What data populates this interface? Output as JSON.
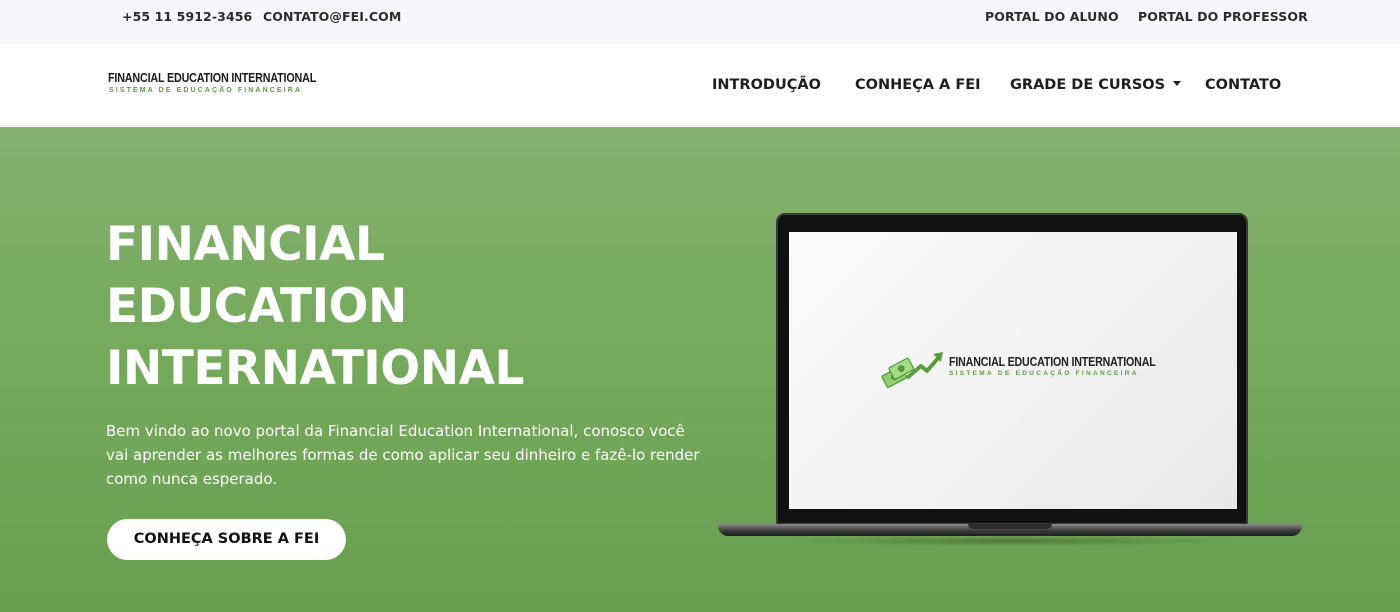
{
  "topbar": {
    "phone": "+55 11 5912-3456",
    "email": "CONTATO@FEI.COM",
    "portal_aluno": "PORTAL DO ALUNO",
    "portal_professor": "PORTAL DO PROFESSOR"
  },
  "brand": {
    "title": "FINANCIAL EDUCATION INTERNATIONAL",
    "subtitle": "SISTEMA DE EDUCAÇÃO FINANCEIRA"
  },
  "nav": {
    "items": [
      {
        "label": "INTRODUÇÃO"
      },
      {
        "label": "CONHEÇA A FEI"
      },
      {
        "label": "GRADE DE CURSOS",
        "has_dropdown": true
      },
      {
        "label": "CONTATO"
      }
    ]
  },
  "hero": {
    "title_lines": [
      "FINANCIAL",
      "EDUCATION",
      "INTERNATIONAL"
    ],
    "description": "Bem vindo ao novo portal da Financial Education International, conosco você vai aprender as melhores formas de como aplicar seu dinheiro e fazê-lo render como nunca esperado.",
    "cta_label": "CONHEÇA SOBRE A FEI"
  },
  "laptop_screen": {
    "logo_title": "FINANCIAL EDUCATION INTERNATIONAL",
    "logo_subtitle": "SISTEMA DE EDUCAÇÃO FINANCEIRA",
    "logo_icon": "money-arrow-up-icon"
  },
  "colors": {
    "hero_green": "#78ab5f",
    "accent_green": "#5a9e3d",
    "topbar_bg": "#f7f7fb"
  }
}
